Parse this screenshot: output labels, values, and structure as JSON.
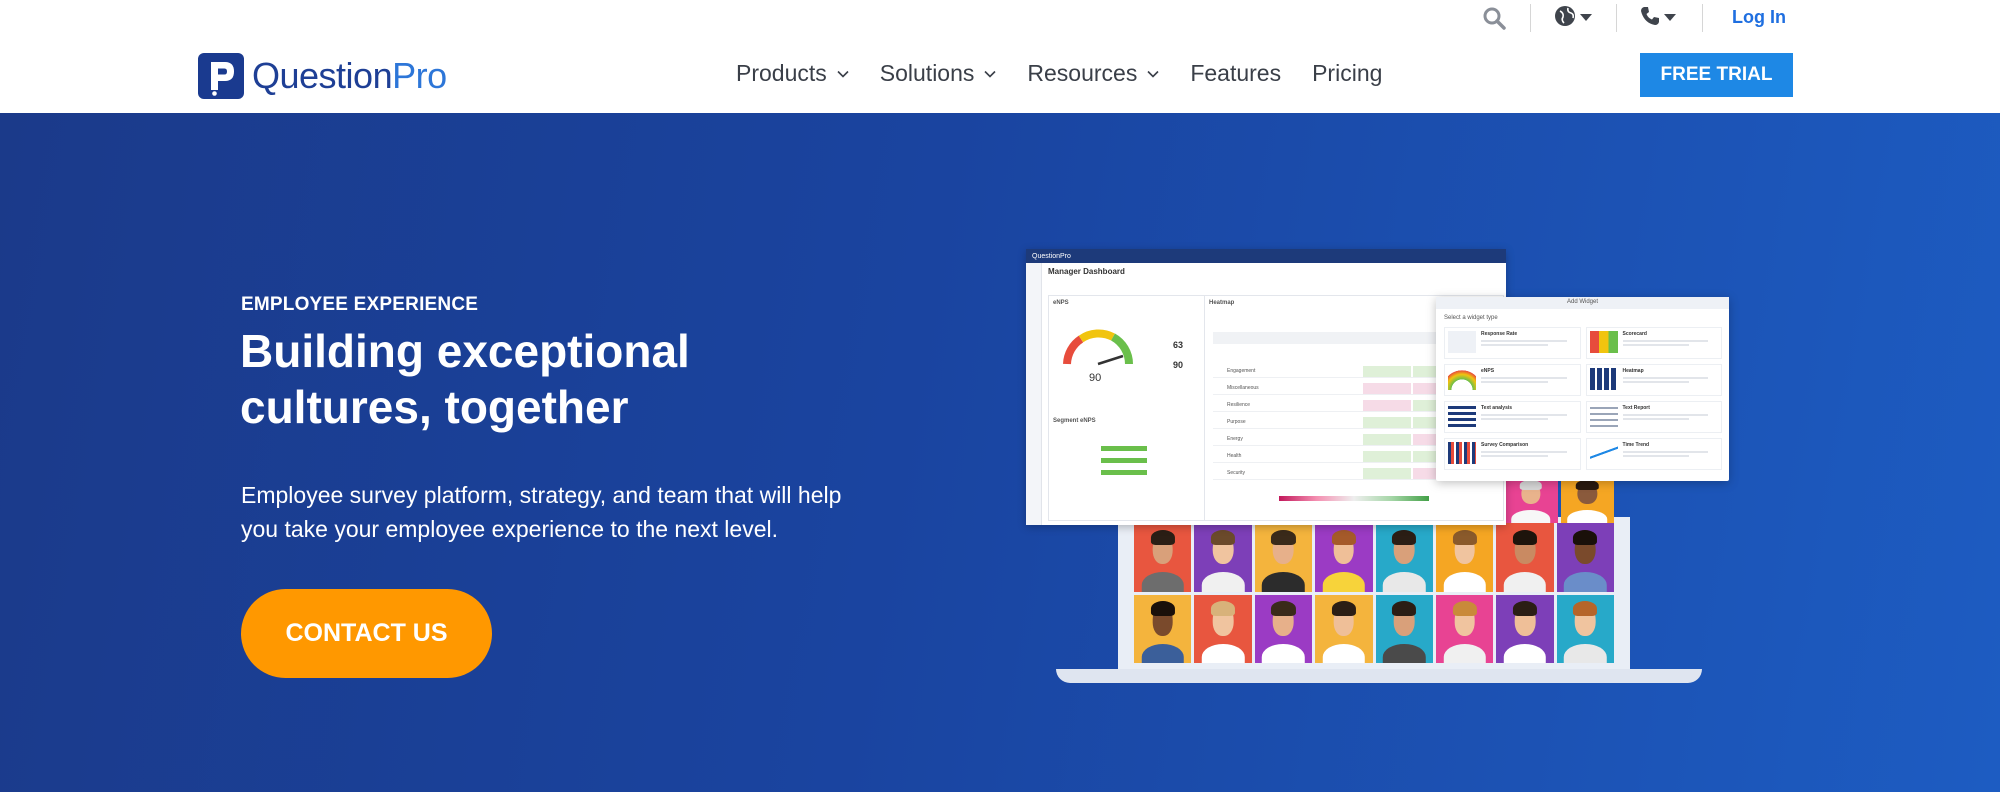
{
  "header": {
    "util": {
      "search_icon": "search-icon",
      "globe_icon": "globe-icon",
      "phone_icon": "phone-icon",
      "login_label": "Log In"
    },
    "logo": {
      "text_a": "Question",
      "text_b": "Pro"
    },
    "nav": [
      {
        "label": "Products",
        "has_dropdown": true
      },
      {
        "label": "Solutions",
        "has_dropdown": true
      },
      {
        "label": "Resources",
        "has_dropdown": true
      },
      {
        "label": "Features",
        "has_dropdown": false
      },
      {
        "label": "Pricing",
        "has_dropdown": false
      }
    ],
    "cta_label": "FREE TRIAL"
  },
  "hero": {
    "eyebrow": "EMPLOYEE EXPERIENCE",
    "headline": "Building exceptional cultures, together",
    "subtext": "Employee survey platform, strategy, and team that will help you take your employee experience to the next level.",
    "cta_label": "CONTACT US"
  },
  "illustration": {
    "dashboard": {
      "app_name": "QuestionPro",
      "title": "Manager Dashboard",
      "enps_card": "eNPS",
      "enps_value": "90",
      "respondents": "63",
      "overall": "90",
      "segment_label": "Segment eNPS",
      "heatmap_card": "Heatmap",
      "heatmap_rows": [
        "Engagement",
        "Miscellaneous",
        "Resilience",
        "Purpose",
        "Energy",
        "Health",
        "Security"
      ]
    },
    "widget": {
      "title": "Add Widget",
      "subtitle": "Select a widget type",
      "items": [
        "Response Rate",
        "Scorecard",
        "eNPS",
        "Heatmap",
        "Text analysis",
        "Text Report",
        "Survey Comparison",
        "Time Trend"
      ]
    }
  },
  "colors": {
    "brand_dark": "#1a3a8f",
    "brand_blue": "#1e88e5",
    "hero_bg": "#1a44a0",
    "cta_orange": "#ff9800"
  }
}
